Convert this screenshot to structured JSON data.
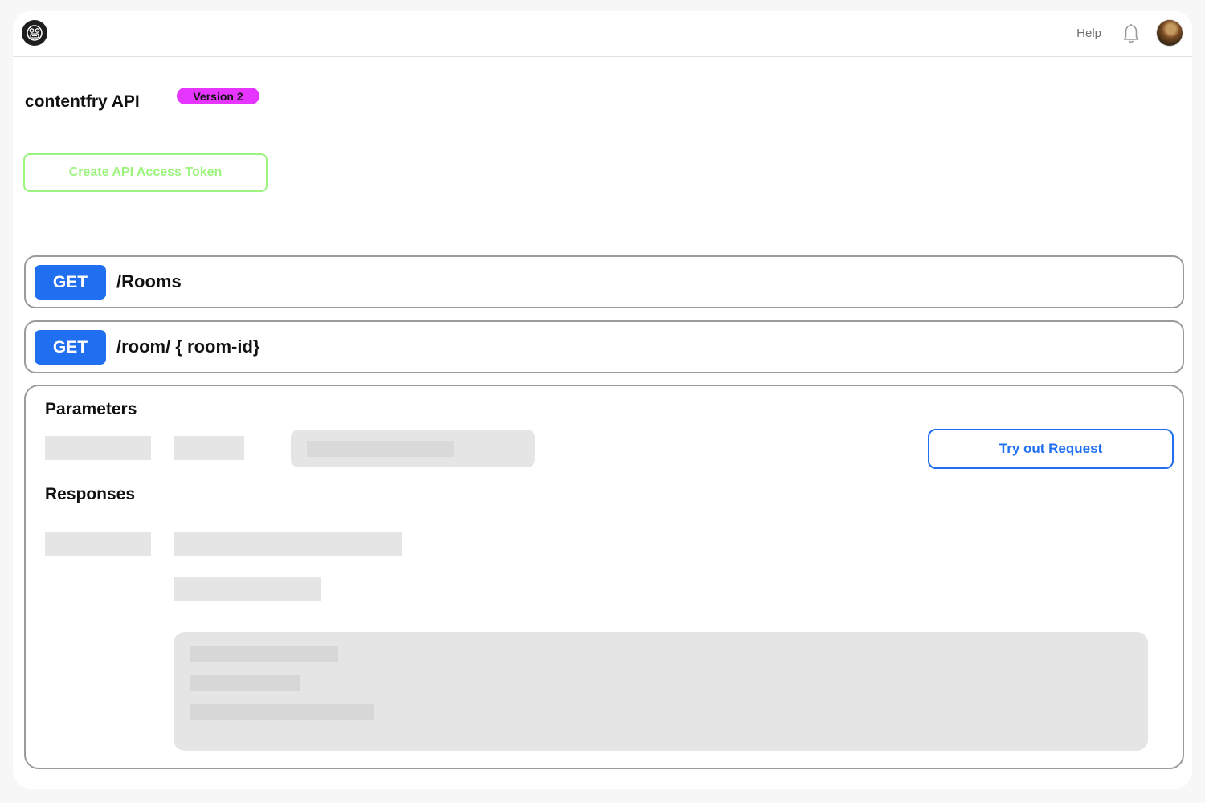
{
  "topbar": {
    "logo_icon": "robot-logo-icon",
    "help_label": "Help",
    "notifications_icon": "bell-icon",
    "avatar_icon": "user-avatar"
  },
  "api": {
    "title": "contentfry API",
    "version_badge": "Version 2",
    "create_token_label": "Create API Access Token"
  },
  "endpoints": [
    {
      "method": "GET",
      "path": "/Rooms"
    },
    {
      "method": "GET",
      "path": "/room/ { room-id}"
    }
  ],
  "details": {
    "parameters_title": "Parameters",
    "responses_title": "Responses",
    "try_button_label": "Try out Request"
  },
  "colors": {
    "accent_blue": "#1f6ff0",
    "badge_magenta": "#e535ff",
    "token_green": "#9cf47f",
    "placeholder_gray": "#e5e5e5"
  }
}
